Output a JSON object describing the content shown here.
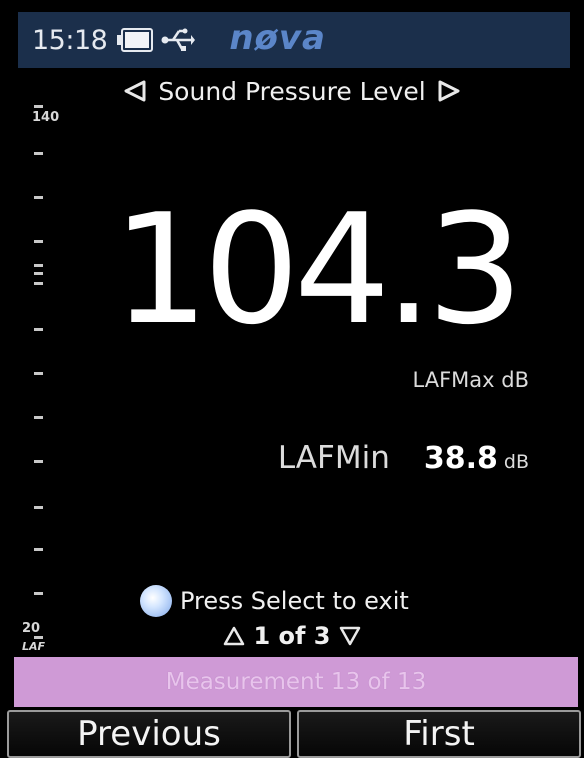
{
  "status_bar": {
    "time": "15:18",
    "battery_icon": "battery-icon",
    "usb_icon": "usb-icon",
    "brand": "nøva"
  },
  "title": {
    "text": "Sound Pressure Level",
    "prev_icon": "arrow-left-icon",
    "next_icon": "arrow-right-icon"
  },
  "scale": {
    "max": "140",
    "min": "20",
    "weighting": "LAF"
  },
  "reading": {
    "value": "104.3",
    "label": "LAFMax dB"
  },
  "secondary": {
    "label": "LAFMin",
    "value": "38.8",
    "unit": "dB"
  },
  "hint": {
    "text": "Press Select to exit",
    "icon": "select-button-icon"
  },
  "page": {
    "text": "1 of 3",
    "up_icon": "page-up-icon",
    "down_icon": "page-down-icon"
  },
  "measurement_bar": {
    "text": "Measurement 13 of 13",
    "color": "#cf9ad6"
  },
  "softkeys": {
    "left": "Previous",
    "right": "First"
  },
  "colors": {
    "status_bar": "#1b2f4b",
    "brand": "#5b86c9",
    "accent": "#5b86c9"
  }
}
